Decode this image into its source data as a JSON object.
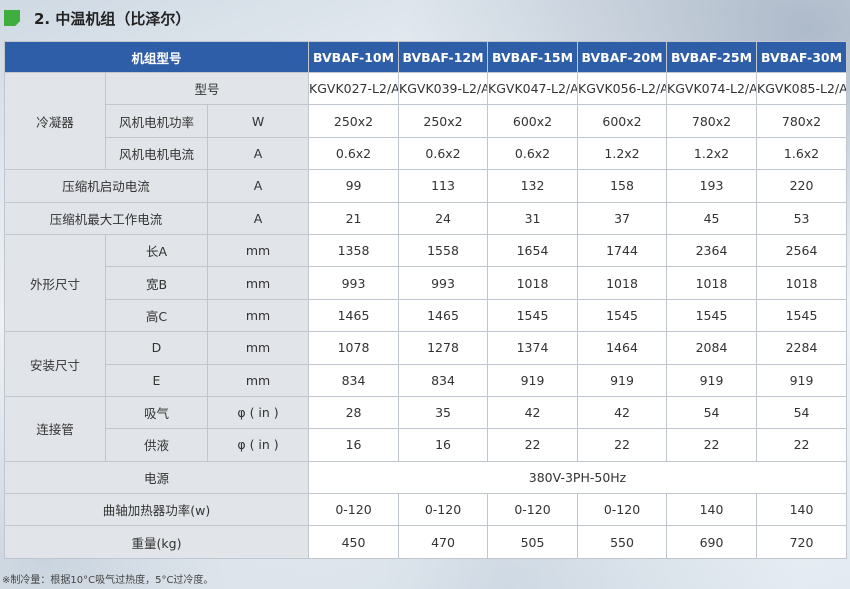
{
  "title": "2. 中温机组（比泽尔）",
  "header": [
    "机组型号",
    "BVBAF-10M",
    "BVBAF-12M",
    "BVBAF-15M",
    "BVBAF-20M",
    "BVBAF-25M",
    "BVBAF-30M"
  ],
  "condenser": {
    "group": "冷凝器",
    "model": {
      "label": "型号",
      "unit": "",
      "values": [
        "KGVK027-L2/A",
        "KGVK039-L2/A",
        "KGVK047-L2/A",
        "KGVK056-L2/A",
        "KGVK074-L2/A",
        "KGVK085-L2/A"
      ]
    },
    "fan_power": {
      "label": "风机电机功率",
      "unit": "W",
      "values": [
        "250x2",
        "250x2",
        "600x2",
        "600x2",
        "780x2",
        "780x2"
      ]
    },
    "fan_current": {
      "label": "风机电机电流",
      "unit": "A",
      "values": [
        "0.6x2",
        "0.6x2",
        "0.6x2",
        "1.2x2",
        "1.2x2",
        "1.6x2"
      ]
    }
  },
  "start_current": {
    "label": "压缩机启动电流",
    "unit": "A",
    "values": [
      "99",
      "113",
      "132",
      "158",
      "193",
      "220"
    ]
  },
  "max_current": {
    "label": "压缩机最大工作电流",
    "unit": "A",
    "values": [
      "21",
      "24",
      "31",
      "37",
      "45",
      "53"
    ]
  },
  "dimensions": {
    "group": "外形尺寸",
    "length": {
      "label": "长A",
      "unit": "mm",
      "values": [
        "1358",
        "1558",
        "1654",
        "1744",
        "2364",
        "2564"
      ]
    },
    "width": {
      "label": "宽B",
      "unit": "mm",
      "values": [
        "993",
        "993",
        "1018",
        "1018",
        "1018",
        "1018"
      ]
    },
    "height": {
      "label": "高C",
      "unit": "mm",
      "values": [
        "1465",
        "1465",
        "1545",
        "1545",
        "1545",
        "1545"
      ]
    }
  },
  "install": {
    "group": "安装尺寸",
    "d": {
      "label": "D",
      "unit": "mm",
      "values": [
        "1078",
        "1278",
        "1374",
        "1464",
        "2084",
        "2284"
      ]
    },
    "e": {
      "label": "E",
      "unit": "mm",
      "values": [
        "834",
        "834",
        "919",
        "919",
        "919",
        "919"
      ]
    }
  },
  "piping": {
    "group": "连接管",
    "suction": {
      "label": "吸气",
      "unit": "φ ( in )",
      "values": [
        "28",
        "35",
        "42",
        "42",
        "54",
        "54"
      ]
    },
    "liquid": {
      "label": "供液",
      "unit": "φ ( in )",
      "values": [
        "16",
        "16",
        "22",
        "22",
        "22",
        "22"
      ]
    }
  },
  "power_supply": {
    "label": "电源",
    "value": "380V-3PH-50Hz"
  },
  "crank_heater": {
    "label": "曲轴加热器功率(w)",
    "values": [
      "0-120",
      "0-120",
      "0-120",
      "0-120",
      "140",
      "140"
    ]
  },
  "weight": {
    "label": "重量(kg)",
    "values": [
      "450",
      "470",
      "505",
      "550",
      "690",
      "720"
    ]
  },
  "footnote": "※制冷量：根据10°C吸气过热度，5°C过冷度。"
}
